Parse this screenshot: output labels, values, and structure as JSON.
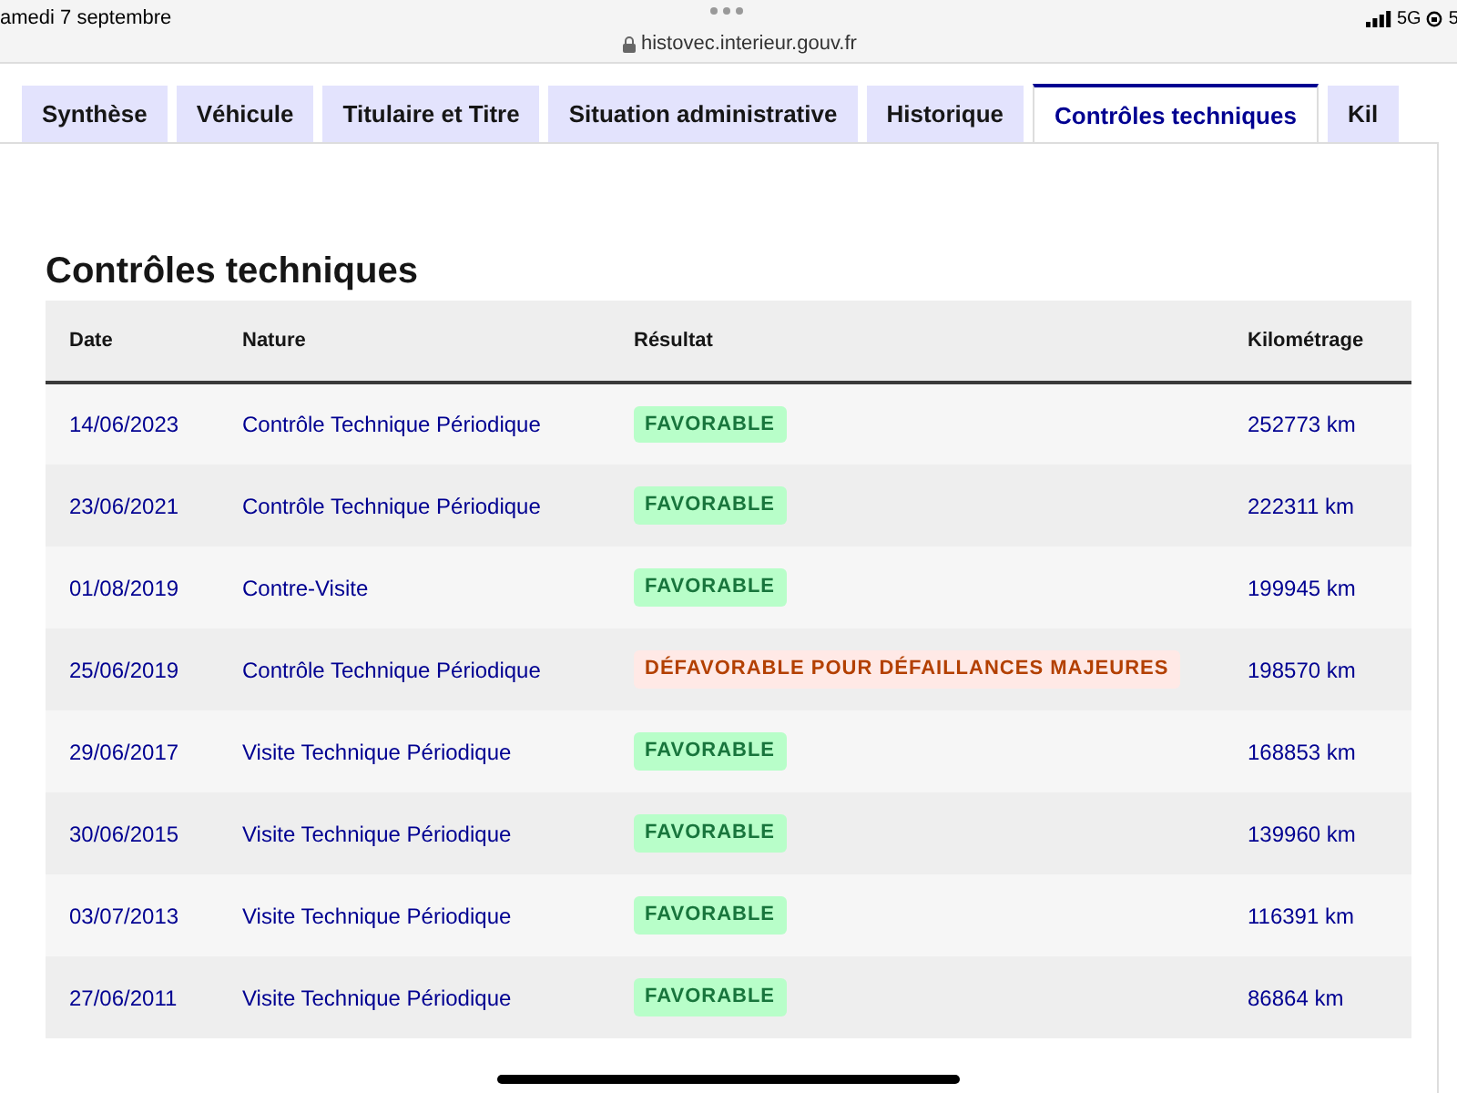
{
  "status_bar": {
    "date": "amedi 7 septembre",
    "url": "histovec.interieur.gouv.fr",
    "network": "5G",
    "battery": "5"
  },
  "tabs": [
    {
      "label": "Synthèse",
      "selected": false
    },
    {
      "label": "Véhicule",
      "selected": false
    },
    {
      "label": "Titulaire et Titre",
      "selected": false
    },
    {
      "label": "Situation administrative",
      "selected": false
    },
    {
      "label": "Historique",
      "selected": false
    },
    {
      "label": "Contrôles techniques",
      "selected": true
    },
    {
      "label": "Kil",
      "selected": false
    }
  ],
  "section": {
    "title": "Contrôles techniques"
  },
  "table": {
    "columns": [
      "Date",
      "Nature",
      "Résultat",
      "Kilométrage"
    ],
    "rows": [
      {
        "date": "14/06/2023",
        "nature": "Contrôle Technique Périodique",
        "result": {
          "label": "FAVORABLE",
          "kind": "favorable"
        },
        "mileage": "252773 km"
      },
      {
        "date": "23/06/2021",
        "nature": "Contrôle Technique Périodique",
        "result": {
          "label": "FAVORABLE",
          "kind": "favorable"
        },
        "mileage": "222311 km"
      },
      {
        "date": "01/08/2019",
        "nature": "Contre-Visite",
        "result": {
          "label": "FAVORABLE",
          "kind": "favorable"
        },
        "mileage": "199945 km"
      },
      {
        "date": "25/06/2019",
        "nature": "Contrôle Technique Périodique",
        "result": {
          "label": "DÉFAVORABLE POUR DÉFAILLANCES MAJEURES",
          "kind": "defavorable"
        },
        "mileage": "198570 km"
      },
      {
        "date": "29/06/2017",
        "nature": "Visite Technique Périodique",
        "result": {
          "label": "FAVORABLE",
          "kind": "favorable"
        },
        "mileage": "168853 km"
      },
      {
        "date": "30/06/2015",
        "nature": "Visite Technique Périodique",
        "result": {
          "label": "FAVORABLE",
          "kind": "favorable"
        },
        "mileage": "139960 km"
      },
      {
        "date": "03/07/2013",
        "nature": "Visite Technique Périodique",
        "result": {
          "label": "FAVORABLE",
          "kind": "favorable"
        },
        "mileage": "116391 km"
      },
      {
        "date": "27/06/2011",
        "nature": "Visite Technique Périodique",
        "result": {
          "label": "FAVORABLE",
          "kind": "favorable"
        },
        "mileage": "86864 km"
      }
    ]
  }
}
